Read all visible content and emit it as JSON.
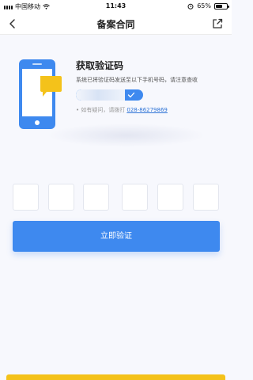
{
  "status_bar": {
    "carrier": "中国移动",
    "time": "11:43",
    "battery_text": "65%",
    "battery_level": 0.65
  },
  "nav": {
    "title": "备案合同",
    "back_icon": "chevron-left-icon",
    "share_icon": "share-icon"
  },
  "verification": {
    "heading": "获取验证码",
    "description": "系统已将验证码发送至以下手机号码，请注意查收",
    "hotline_prefix": "• 如有疑问，请拨打",
    "hotline_number": "028-86279869",
    "code_length": 6,
    "verify_button": "立即验证"
  },
  "colors": {
    "primary": "#3e89ef",
    "accent_yellow": "#f4c21a",
    "background": "#f7f8fd"
  }
}
